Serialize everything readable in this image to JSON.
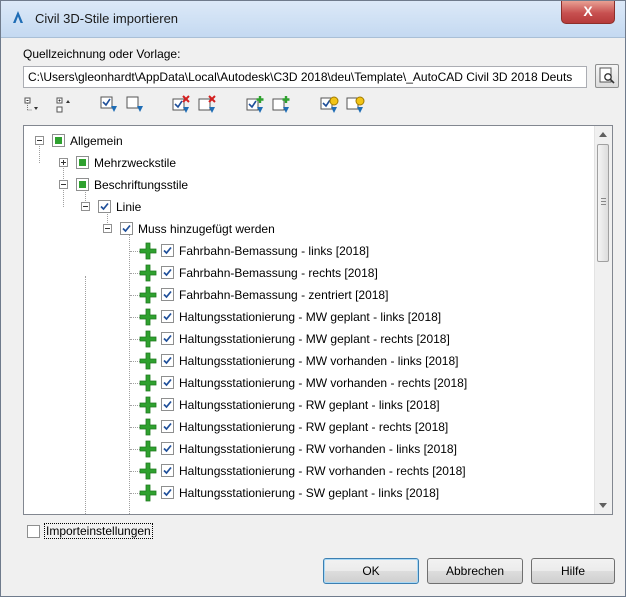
{
  "window": {
    "title": "Civil 3D-Stile importieren",
    "close_label": "X"
  },
  "source": {
    "label": "Quellzeichnung oder Vorlage:",
    "path": "C:\\Users\\gleonhardt\\AppData\\Local\\Autodesk\\C3D 2018\\deu\\Template\\_AutoCAD Civil 3D 2018 Deuts"
  },
  "toolbar": {
    "icons": [
      "collapse-all-icon",
      "expand-all-icon",
      "select-all-icon",
      "deselect-all-icon",
      "delete-select-icon",
      "delete-deselect-icon",
      "add-select-icon",
      "add-deselect-icon",
      "update-select-icon",
      "update-deselect-icon"
    ]
  },
  "tree": {
    "root": "Allgemein",
    "multi": "Mehrzweckstile",
    "label_styles": "Beschriftungsstile",
    "line": "Linie",
    "must_add": "Muss hinzugefügt werden",
    "items": [
      "Fahrbahn-Bemassung - links [2018]",
      "Fahrbahn-Bemassung - rechts [2018]",
      "Fahrbahn-Bemassung - zentriert [2018]",
      "Haltungsstationierung - MW geplant -  links [2018]",
      "Haltungsstationierung - MW geplant - rechts [2018]",
      "Haltungsstationierung - MW vorhanden -  links [2018]",
      "Haltungsstationierung - MW vorhanden - rechts [2018]",
      "Haltungsstationierung - RW geplant -  links [2018]",
      "Haltungsstationierung - RW geplant - rechts [2018]",
      "Haltungsstationierung - RW vorhanden -  links [2018]",
      "Haltungsstationierung - RW vorhanden - rechts [2018]",
      "Haltungsstationierung - SW geplant -  links [2018]"
    ]
  },
  "settings": {
    "label": "Importeinstellungen"
  },
  "buttons": {
    "ok": "OK",
    "cancel": "Abbrechen",
    "help": "Hilfe"
  },
  "colors": {
    "add_green": "#2fa12f",
    "check_blue": "#1f4f9a",
    "title_gradient_top": "#dce9f8"
  }
}
